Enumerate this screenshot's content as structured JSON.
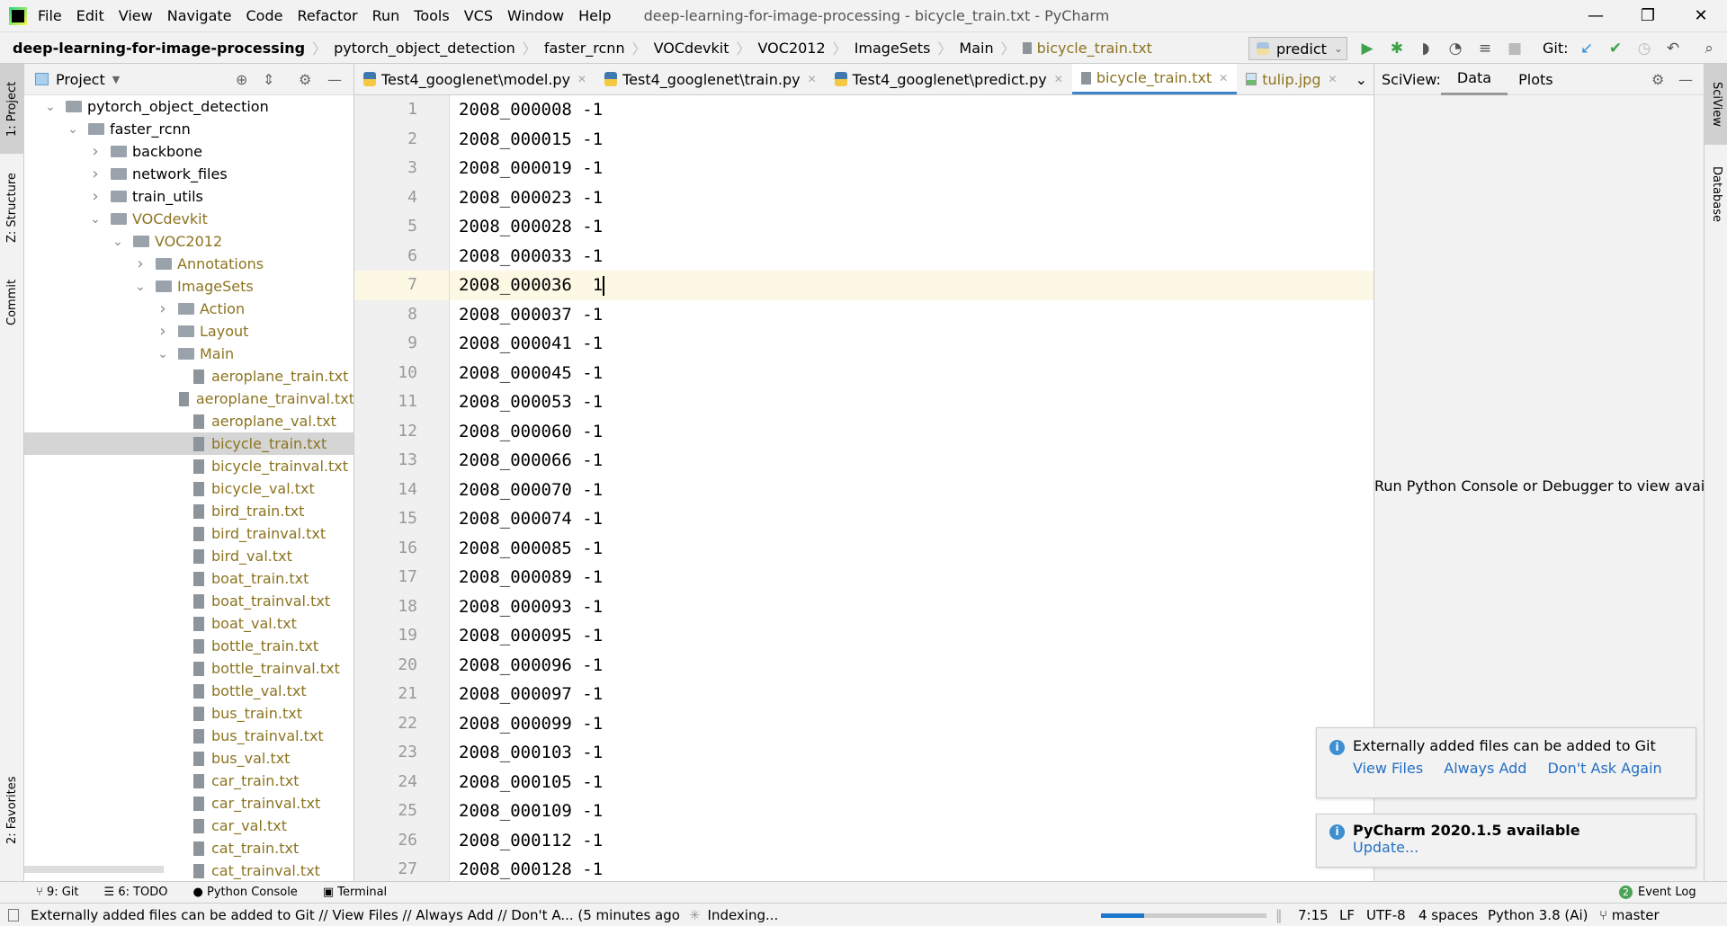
{
  "window": {
    "title": "deep-learning-for-image-processing - bicycle_train.txt - PyCharm",
    "minimize": "—",
    "restore": "❐",
    "close": "✕"
  },
  "menu": [
    "File",
    "Edit",
    "View",
    "Navigate",
    "Code",
    "Refactor",
    "Run",
    "Tools",
    "VCS",
    "Window",
    "Help"
  ],
  "breadcrumb": [
    "deep-learning-for-image-processing",
    "pytorch_object_detection",
    "faster_rcnn",
    "VOCdevkit",
    "VOC2012",
    "ImageSets",
    "Main",
    "bicycle_train.txt"
  ],
  "toolbar": {
    "run_config": "predict",
    "git_label": "Git:"
  },
  "left_strip": [
    "1: Project",
    "Z: Structure",
    "Commit",
    "2: Favorites"
  ],
  "project": {
    "title": "Project",
    "tree": [
      {
        "label": "pytorch_object_detection",
        "level": 0,
        "type": "folder",
        "open": true
      },
      {
        "label": "faster_rcnn",
        "level": 1,
        "type": "folder",
        "open": true
      },
      {
        "label": "backbone",
        "level": 2,
        "type": "folder",
        "open": false
      },
      {
        "label": "network_files",
        "level": 2,
        "type": "folder",
        "open": false
      },
      {
        "label": "train_utils",
        "level": 2,
        "type": "folder",
        "open": false
      },
      {
        "label": "VOCdevkit",
        "level": 2,
        "type": "folder",
        "open": true,
        "untracked": true
      },
      {
        "label": "VOC2012",
        "level": 3,
        "type": "folder",
        "open": true,
        "untracked": true
      },
      {
        "label": "Annotations",
        "level": 4,
        "type": "folder",
        "open": false,
        "untracked": true
      },
      {
        "label": "ImageSets",
        "level": 4,
        "type": "folder",
        "open": true,
        "untracked": true
      },
      {
        "label": "Action",
        "level": 5,
        "type": "folder",
        "open": false,
        "untracked": true
      },
      {
        "label": "Layout",
        "level": 5,
        "type": "folder",
        "open": false,
        "untracked": true
      },
      {
        "label": "Main",
        "level": 5,
        "type": "folder",
        "open": true,
        "untracked": true
      },
      {
        "label": "aeroplane_train.txt",
        "level": 6,
        "type": "file"
      },
      {
        "label": "aeroplane_trainval.txt",
        "level": 6,
        "type": "file"
      },
      {
        "label": "aeroplane_val.txt",
        "level": 6,
        "type": "file"
      },
      {
        "label": "bicycle_train.txt",
        "level": 6,
        "type": "file",
        "selected": true
      },
      {
        "label": "bicycle_trainval.txt",
        "level": 6,
        "type": "file"
      },
      {
        "label": "bicycle_val.txt",
        "level": 6,
        "type": "file"
      },
      {
        "label": "bird_train.txt",
        "level": 6,
        "type": "file"
      },
      {
        "label": "bird_trainval.txt",
        "level": 6,
        "type": "file"
      },
      {
        "label": "bird_val.txt",
        "level": 6,
        "type": "file"
      },
      {
        "label": "boat_train.txt",
        "level": 6,
        "type": "file"
      },
      {
        "label": "boat_trainval.txt",
        "level": 6,
        "type": "file"
      },
      {
        "label": "boat_val.txt",
        "level": 6,
        "type": "file"
      },
      {
        "label": "bottle_train.txt",
        "level": 6,
        "type": "file"
      },
      {
        "label": "bottle_trainval.txt",
        "level": 6,
        "type": "file"
      },
      {
        "label": "bottle_val.txt",
        "level": 6,
        "type": "file"
      },
      {
        "label": "bus_train.txt",
        "level": 6,
        "type": "file"
      },
      {
        "label": "bus_trainval.txt",
        "level": 6,
        "type": "file"
      },
      {
        "label": "bus_val.txt",
        "level": 6,
        "type": "file"
      },
      {
        "label": "car_train.txt",
        "level": 6,
        "type": "file"
      },
      {
        "label": "car_trainval.txt",
        "level": 6,
        "type": "file"
      },
      {
        "label": "car_val.txt",
        "level": 6,
        "type": "file"
      },
      {
        "label": "cat_train.txt",
        "level": 6,
        "type": "file"
      },
      {
        "label": "cat_trainval.txt",
        "level": 6,
        "type": "file"
      }
    ]
  },
  "tabs": [
    {
      "label": "Test4_googlenet\\model.py",
      "kind": "py"
    },
    {
      "label": "Test4_googlenet\\train.py",
      "kind": "py"
    },
    {
      "label": "Test4_googlenet\\predict.py",
      "kind": "py"
    },
    {
      "label": "bicycle_train.txt",
      "kind": "txt",
      "active": true
    },
    {
      "label": "tulip.jpg",
      "kind": "img"
    }
  ],
  "editor": {
    "current_line": 7,
    "lines": [
      "2008_000008 -1",
      "2008_000015 -1",
      "2008_000019 -1",
      "2008_000023 -1",
      "2008_000028 -1",
      "2008_000033 -1",
      "2008_000036  1",
      "2008_000037 -1",
      "2008_000041 -1",
      "2008_000045 -1",
      "2008_000053 -1",
      "2008_000060 -1",
      "2008_000066 -1",
      "2008_000070 -1",
      "2008_000074 -1",
      "2008_000085 -1",
      "2008_000089 -1",
      "2008_000093 -1",
      "2008_000095 -1",
      "2008_000096 -1",
      "2008_000097 -1",
      "2008_000099 -1",
      "2008_000103 -1",
      "2008_000105 -1",
      "2008_000109 -1",
      "2008_000112 -1",
      "2008_000128 -1"
    ]
  },
  "sciview": {
    "label": "SciView:",
    "tabs": [
      "Data",
      "Plots"
    ],
    "message": "Run Python Console or Debugger to view available"
  },
  "right_strip": [
    "SciView",
    "Database"
  ],
  "notifications": [
    {
      "title": "Externally added files can be added to Git",
      "actions": [
        "View Files",
        "Always Add",
        "Don't Ask Again"
      ]
    },
    {
      "title": "PyCharm 2020.1.5 available",
      "actions": [
        "Update..."
      ]
    }
  ],
  "bottom_tools": [
    "9: Git",
    "6: TODO",
    "Python Console",
    "Terminal"
  ],
  "event_log": {
    "label": "Event Log",
    "count": "2"
  },
  "status": {
    "message": "Externally added files can be added to Git // View Files // Always Add // Don't A... (5 minutes ago",
    "indexing": "Indexing...",
    "progress": 0.26,
    "position": "7:15",
    "line_sep": "LF",
    "encoding": "UTF-8",
    "indent": "4 spaces",
    "interpreter": "Python 3.8 (Ai)",
    "branch": "master"
  },
  "colors": {
    "accent": "#4083c9",
    "link": "#2470c2",
    "untracked": "#8c7420",
    "current_line": "#fdf8e4"
  }
}
